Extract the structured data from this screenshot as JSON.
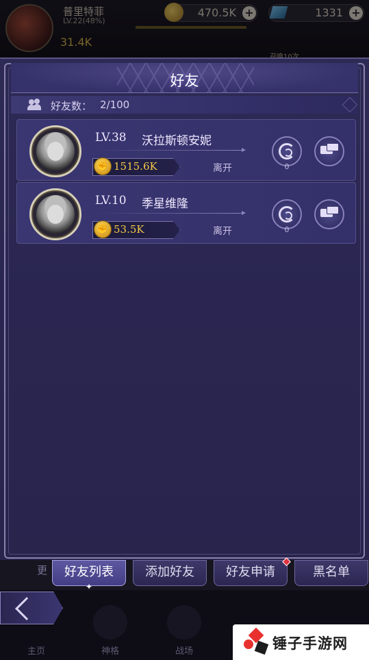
{
  "hud": {
    "player_name": "普里特菲",
    "player_level": "LV.22(48%)",
    "power": "31.4K",
    "gold": "470.5K",
    "gems": "1331",
    "summon_hint": "召唤10次"
  },
  "panel": {
    "title": "好友",
    "friend_count_label": "好友数：",
    "friend_count_value": "2/100"
  },
  "friends": [
    {
      "level": "LV.38",
      "name": "沃拉斯顿安妮",
      "power": "1515.6K",
      "status": "离开",
      "gift_count": "0"
    },
    {
      "level": "LV.10",
      "name": "季星维隆",
      "power": "53.5K",
      "status": "离开",
      "gift_count": "0"
    }
  ],
  "tabs": {
    "friend_list": "好友列表",
    "add_friend": "添加好友",
    "friend_requests": "好友申请",
    "blacklist": "黑名单",
    "left_fragment": "更"
  },
  "nav": {
    "home": "主页",
    "deity": "神格",
    "battle": "战场"
  },
  "watermark": "锤子手游网",
  "colors": {
    "panel_bg": "#2d2a55",
    "power_text": "#f4c948",
    "notification": "#e0313f"
  }
}
